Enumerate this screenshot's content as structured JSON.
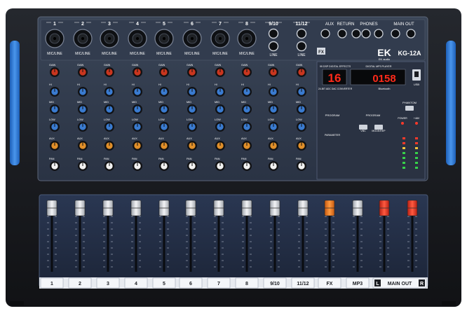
{
  "brand": {
    "logo_text": "EK",
    "logo_sub": "EK audio",
    "model": "KG-12A"
  },
  "top_labels": {
    "channels": [
      "1",
      "2",
      "3",
      "4",
      "5",
      "6",
      "7",
      "8",
      "9/10",
      "11/12"
    ],
    "aux": "AUX",
    "return": "RETURN",
    "phones": "PHONES",
    "main_out": "MAIN OUT"
  },
  "input_labels": {
    "mono": "MIC/LINE",
    "stereo": "LINE"
  },
  "knob_labels": [
    "GAIN",
    "HI",
    "MID",
    "LOW",
    "AUX",
    "FX",
    "PAN"
  ],
  "fx_box": "FX",
  "display": {
    "digits": "16",
    "counter": "0158",
    "title": "99 DSP DIGITAL EFFECTS",
    "player_title": "DIGITAL MP3 PLAYER",
    "sub1": "24-BIT ADC DAC CONVERTER",
    "bluetooth": "Bluetooth",
    "usb": "USB"
  },
  "dsp": {
    "program_label": "PROGRAM",
    "parameter_label": "PARAMETER",
    "phantom": "PHANTOM",
    "power": "POWER",
    "voltage": "+48V",
    "vbc": "VBC",
    "mode": "MODE/REP"
  },
  "fader_labels": [
    "1",
    "2",
    "3",
    "4",
    "5",
    "6",
    "7",
    "8",
    "9/10",
    "11/12",
    "FX",
    "MP3"
  ],
  "main_out_strip": {
    "left": "L",
    "label": "MAIN OUT",
    "right": "R"
  },
  "fader_scale": [
    "10",
    "5",
    "0",
    "5",
    "10",
    "20",
    "30",
    "40",
    "50",
    "∞"
  ],
  "colors": {
    "body": "#1b1d22",
    "panel": "#2b3445",
    "fader_panel": "#243049",
    "accent_blue": "#2f7bd6",
    "red": "#e33122",
    "orange": "#f07a22",
    "silver": "#d8dce2"
  }
}
